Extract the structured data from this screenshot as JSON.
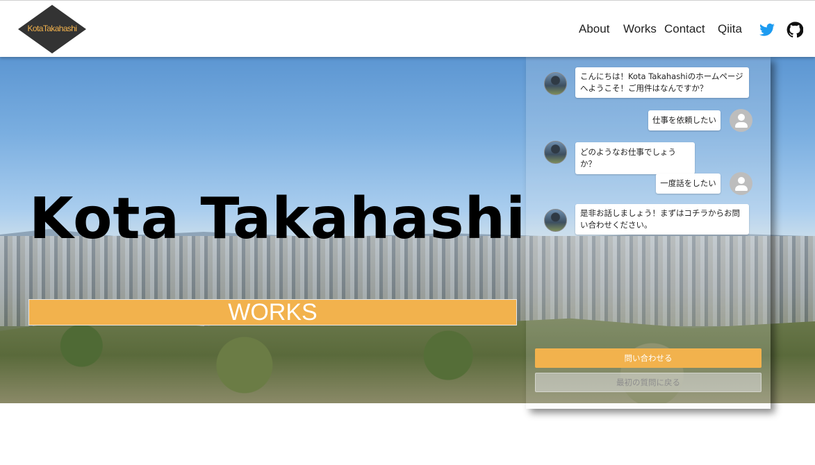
{
  "header": {
    "logo_text": "KotaTakahashi",
    "nav": [
      {
        "label": "About"
      },
      {
        "label": "Works"
      },
      {
        "label": "Contact"
      },
      {
        "label": "Qiita"
      }
    ],
    "icons": [
      "twitter-icon",
      "github-icon"
    ],
    "twitter_color": "#1d9bf0"
  },
  "hero": {
    "title": "Kota Takahashi",
    "banner": "WORKS",
    "accent_color": "#f2b24d"
  },
  "chat": {
    "messages": [
      {
        "from": "bot",
        "text": "こんにちは！Kota Takahashiのホームページへようこそ！ご用件はなんですか？"
      },
      {
        "from": "user",
        "text": "仕事を依頼したい"
      },
      {
        "from": "bot",
        "text": "どのようなお仕事でしょうか？"
      },
      {
        "from": "user",
        "text": "一度話をしたい"
      },
      {
        "from": "bot",
        "text": "是非お話しましょう！まずはコチラからお問い合わせください。"
      }
    ],
    "contact_button": "問い合わせる",
    "back_button": "最初の質問に戻る"
  }
}
